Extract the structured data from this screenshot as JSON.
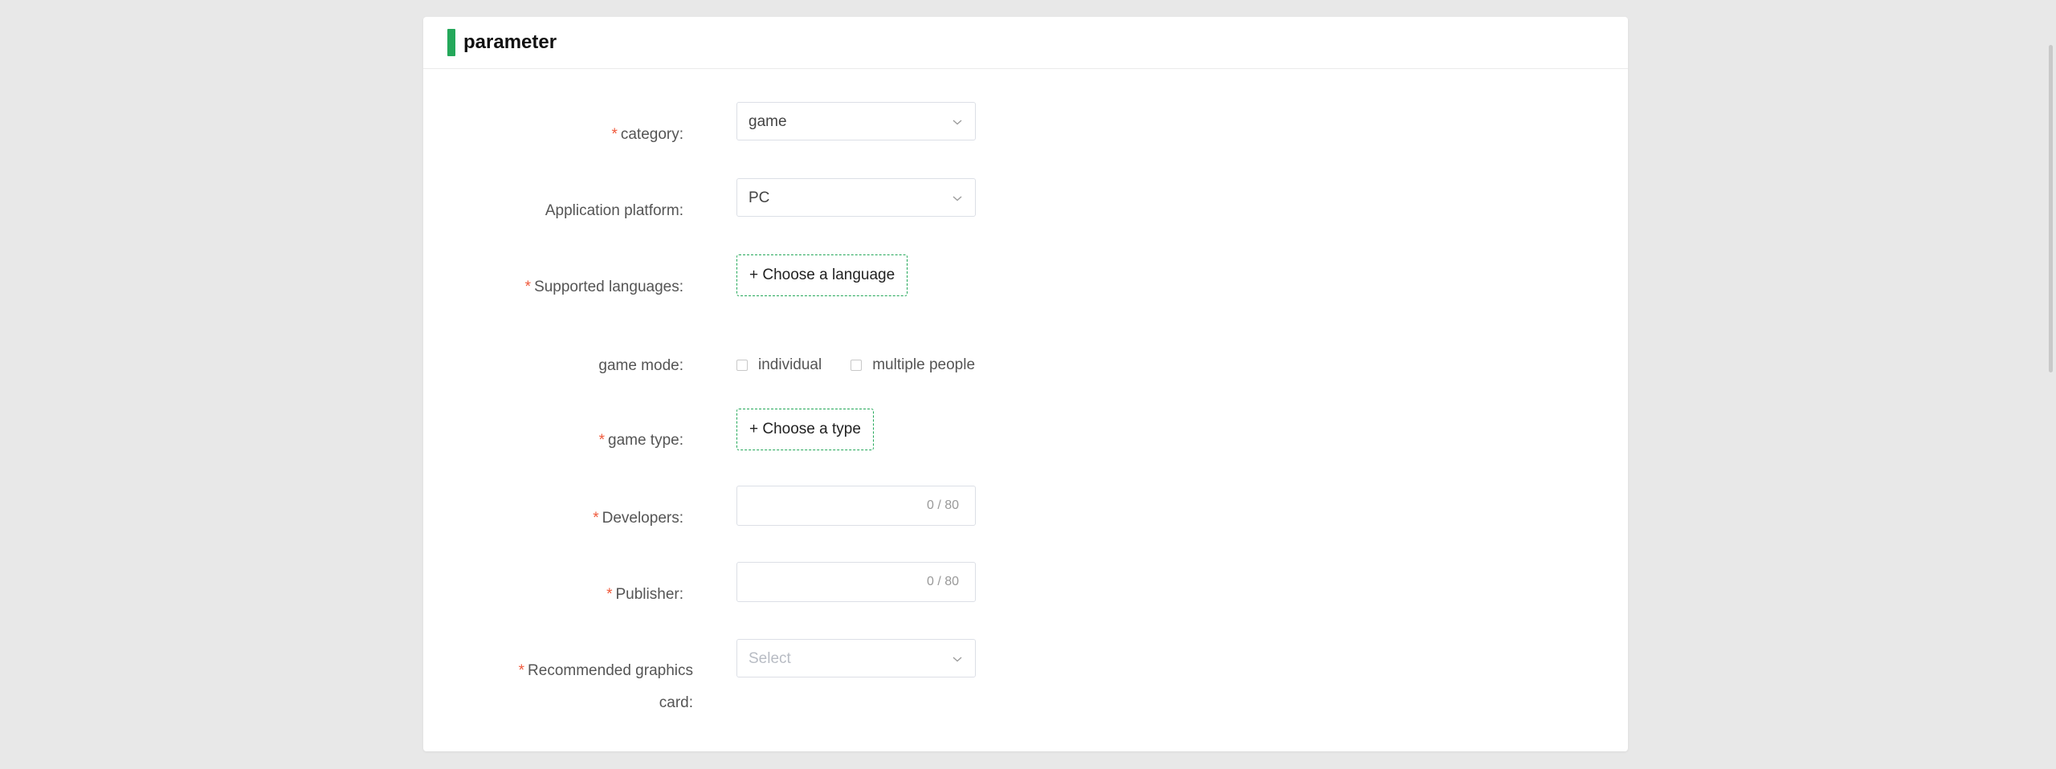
{
  "section": {
    "title": "parameter",
    "accent_color": "#24a85a"
  },
  "required_color": "#f05a3c",
  "required_mark": "*",
  "fields": {
    "category": {
      "label": "category:",
      "value": "game",
      "required": true
    },
    "platform": {
      "label": "Application platform:",
      "value": "PC",
      "required": false
    },
    "languages": {
      "label": "Supported languages:",
      "button": "+ Choose a language",
      "required": true
    },
    "game_mode": {
      "label": "game mode:",
      "options": [
        "individual",
        "multiple people"
      ],
      "checked": [
        false,
        false
      ],
      "required": false
    },
    "game_type": {
      "label": "game type:",
      "button": "+ Choose a type",
      "required": true
    },
    "developers": {
      "label": "Developers:",
      "counter": "0 / 80",
      "value": "",
      "required": true
    },
    "publisher": {
      "label": "Publisher:",
      "counter": "0 / 80",
      "value": "",
      "required": true
    },
    "graphics_card": {
      "label": "Recommended graphics card:",
      "placeholder": "Select",
      "required": true
    }
  },
  "icons": {
    "dropdown": "chevron-down-icon"
  }
}
